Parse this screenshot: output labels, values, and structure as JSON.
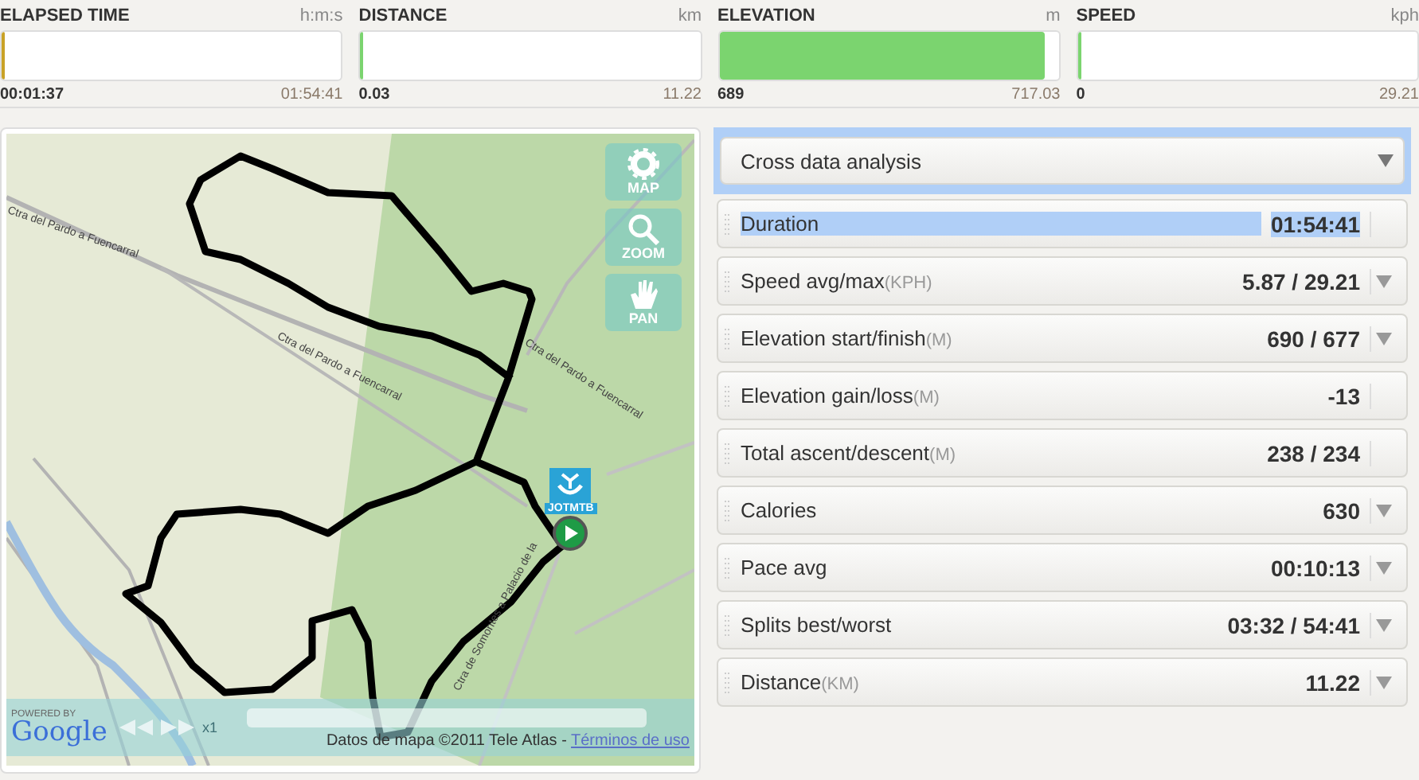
{
  "meters": [
    {
      "label": "ELAPSED TIME",
      "unit": "h:m:s",
      "level": 0.01,
      "color": "#c9a227",
      "current": "00:01:37",
      "total": "01:54:41"
    },
    {
      "label": "DISTANCE",
      "unit": "km",
      "level": 0.003,
      "color": "#7bd46f",
      "current": "0.03",
      "total": "11.22"
    },
    {
      "label": "ELEVATION",
      "unit": "m",
      "level": 0.96,
      "color": "#7bd46f",
      "current": "689",
      "total": "717.03"
    },
    {
      "label": "SPEED",
      "unit": "kph",
      "level": 0,
      "color": "#7bd46f",
      "current": "0",
      "total": "29.21"
    }
  ],
  "map": {
    "road_labels": [
      "Ctra del Pardo a Fuencarral",
      "Ctra del Pardo a Fuencarral",
      "Ctra del Pardo a Fuencarral",
      "Ctra de Somontes a Palacio de la"
    ],
    "controls": [
      "MAP",
      "ZOOM",
      "PAN"
    ],
    "marker_label": "JOTMTB",
    "powered_by": "POWERED BY",
    "logo": "Google",
    "speed": "x1",
    "attribution": "Datos de mapa ©2011 Tele Atlas - ",
    "terms_link": "Términos de uso"
  },
  "analysis": {
    "title": "Cross data analysis",
    "selected": true
  },
  "stats": [
    {
      "label": "Duration",
      "value": "01:54:41",
      "dropdown": false,
      "selected": true
    },
    {
      "label": "Speed avg/max",
      "unit": "(KPH)",
      "value": "5.87 / 29.21",
      "dropdown": true,
      "selected": false
    },
    {
      "label": "Elevation start/finish",
      "unit": "(M)",
      "value": "690 / 677",
      "dropdown": true,
      "selected": false
    },
    {
      "label": "Elevation gain/loss",
      "unit": "(M)",
      "value": "-13",
      "dropdown": false,
      "selected": false
    },
    {
      "label": "Total ascent/descent",
      "unit": "(M)",
      "value": "238 / 234",
      "dropdown": false,
      "selected": false
    },
    {
      "label": "Calories",
      "value": "630",
      "dropdown": true,
      "selected": false
    },
    {
      "label": "Pace avg",
      "value": "00:10:13",
      "dropdown": true,
      "selected": false
    },
    {
      "label": "Splits best/worst",
      "value": "03:32 / 54:41",
      "dropdown": true,
      "selected": false
    },
    {
      "label": "Distance",
      "unit": "(KM)",
      "value": "11.22",
      "dropdown": true,
      "selected": false
    }
  ]
}
